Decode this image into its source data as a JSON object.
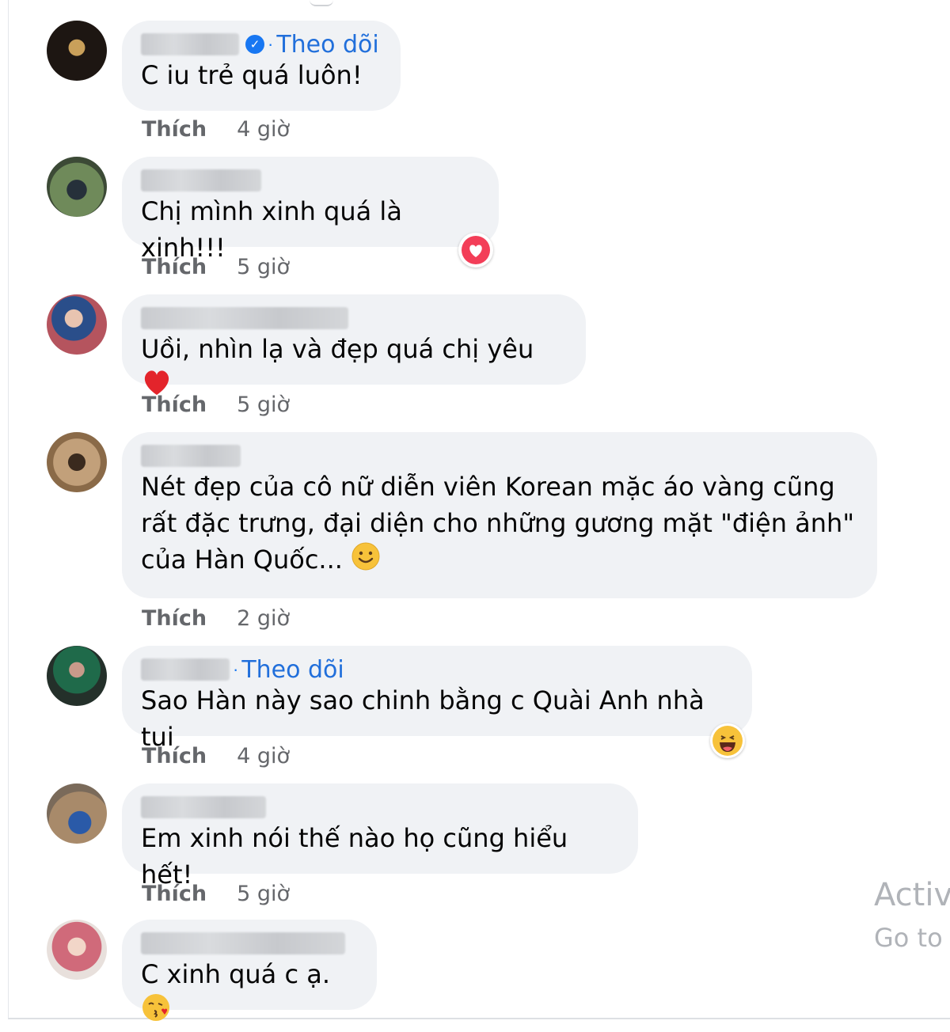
{
  "comments": [
    {
      "follow": "Theo dõi",
      "verified": true,
      "text": "C iu trẻ quá luôn!",
      "like": "Thích",
      "time": "4 giờ",
      "avatar_color": "#3a2a22"
    },
    {
      "follow": "",
      "verified": false,
      "text": "Chị mình xinh quá là xinh!!!",
      "like": "Thích",
      "time": "5 giờ",
      "avatar_color": "#4a5a48",
      "reaction": "love"
    },
    {
      "follow": "",
      "verified": false,
      "text": "Uồi, nhìn lạ và đẹp quá chị yêu",
      "like": "Thích",
      "time": "5 giờ",
      "avatar_color": "#7a4a5a",
      "emoji": "heart"
    },
    {
      "follow": "",
      "verified": false,
      "text": "Nét đẹp của cô nữ diễn viên Korean mặc áo vàng cũng\nrất đặc trưng, đại diện cho những gương mặt \"điện ảnh\"\ncủa Hàn Quốc...",
      "like": "Thích",
      "time": "2 giờ",
      "avatar_color": "#8a6a48",
      "emoji": "smile"
    },
    {
      "follow": "Theo dõi",
      "verified": false,
      "text": "Sao Hàn này sao chinh bằng c Quài Anh nhà tui",
      "like": "Thích",
      "time": "4 giờ",
      "avatar_color": "#2f5a3a",
      "reaction": "haha"
    },
    {
      "follow": "",
      "verified": false,
      "text": "Em xinh nói thế nào họ cũng hiểu hết!",
      "like": "Thích",
      "time": "5 giờ",
      "avatar_color": "#3f5f7a"
    },
    {
      "follow": "",
      "verified": false,
      "text": "C xinh quá c ạ.",
      "like": "Thích",
      "time": "",
      "avatar_color": "#c98a7a",
      "emoji": "kiss"
    }
  ],
  "watermark": {
    "line1": "Activ",
    "line2": "Go to"
  }
}
